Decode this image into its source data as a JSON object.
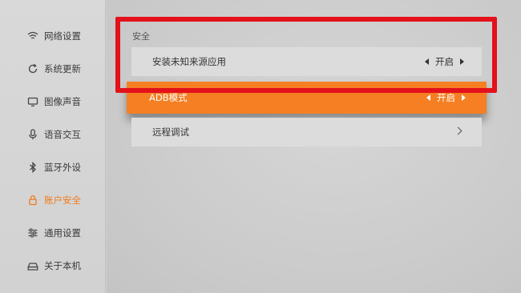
{
  "sidebar": {
    "items": [
      {
        "label": "网络设置",
        "icon": "wifi-icon",
        "active": false
      },
      {
        "label": "系统更新",
        "icon": "refresh-icon",
        "active": false
      },
      {
        "label": "图像声音",
        "icon": "monitor-icon",
        "active": false
      },
      {
        "label": "语音交互",
        "icon": "microphone-icon",
        "active": false
      },
      {
        "label": "蓝牙外设",
        "icon": "bluetooth-icon",
        "active": false
      },
      {
        "label": "账户安全",
        "icon": "lock-icon",
        "active": true
      },
      {
        "label": "通用设置",
        "icon": "sliders-icon",
        "active": false
      },
      {
        "label": "关于本机",
        "icon": "device-icon",
        "active": false
      }
    ]
  },
  "main": {
    "section_title": "安全",
    "rows": [
      {
        "label": "安装未知来源应用",
        "value": "开启"
      },
      {
        "label": "ADB模式",
        "value": "开启"
      },
      {
        "label": "远程调试"
      }
    ]
  },
  "colors": {
    "accent": "#f57f22",
    "highlight_border": "#e3111a",
    "background": "#cfcfcf"
  }
}
